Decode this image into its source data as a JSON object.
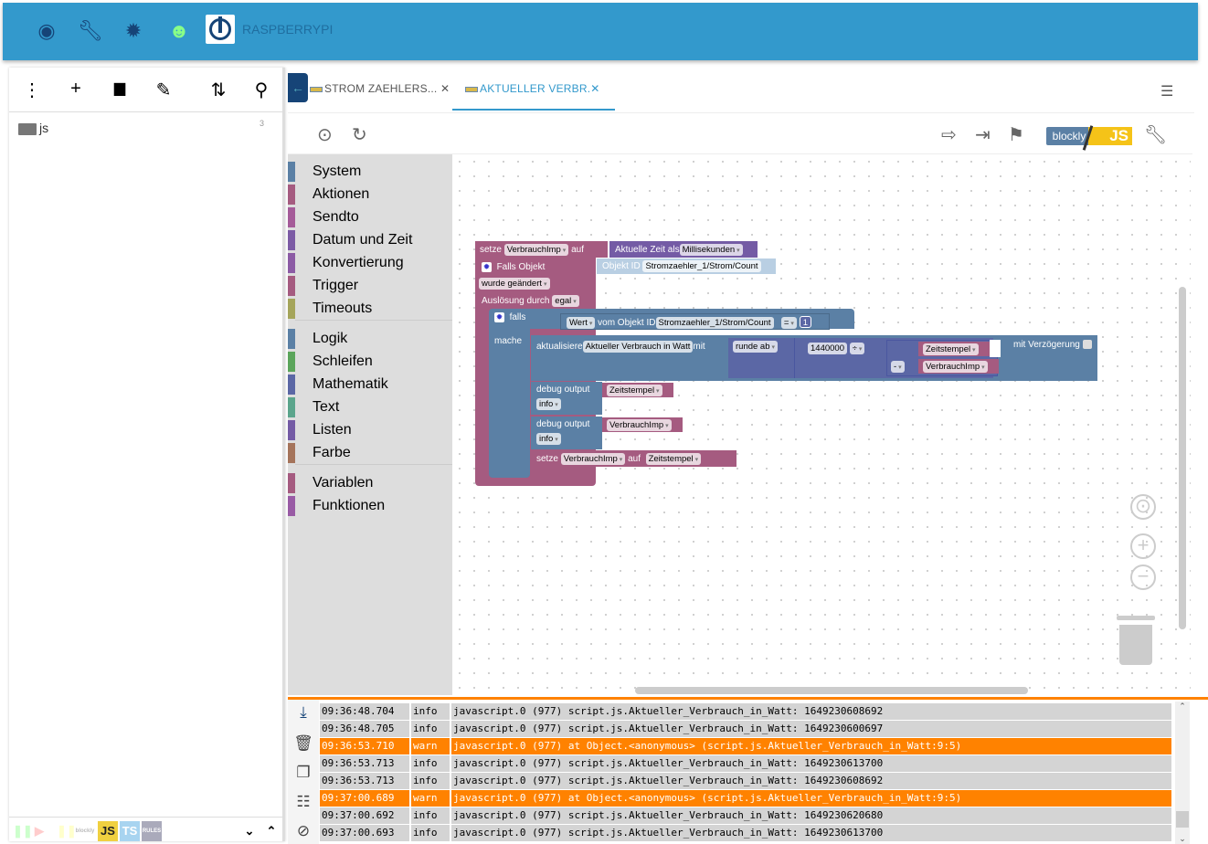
{
  "header": {
    "host": "RASPBERRYPI",
    "icons": [
      "eye-icon",
      "wrench-icon",
      "brightness-icon",
      "head-icon",
      "iobroker-logo"
    ]
  },
  "explorer": {
    "icons": [
      "more-icon",
      "add-icon",
      "add-folder-icon",
      "edit-icon",
      "sort-icon",
      "search-icon"
    ],
    "folder": {
      "name": "js",
      "count": "3"
    },
    "bottom": {
      "js": "JS",
      "ts": "TS",
      "rules": "RULES",
      "blockly": "blockly"
    }
  },
  "tabs": [
    {
      "label": "STROM ZAEHLERS...",
      "active": false
    },
    {
      "label": "AKTUELLER VERBR.",
      "active": true
    }
  ],
  "toolbar": {
    "blockly": "blockly",
    "js": "JS"
  },
  "categories": [
    {
      "label": "System",
      "color": "#5b80a5"
    },
    {
      "label": "Aktionen",
      "color": "#a55b80"
    },
    {
      "label": "Sendto",
      "color": "#a55b99"
    },
    {
      "label": "Datum und Zeit",
      "color": "#7c5ba5"
    },
    {
      "label": "Konvertierung",
      "color": "#8c5ba5"
    },
    {
      "label": "Trigger",
      "color": "#a55b80"
    },
    {
      "label": "Timeouts",
      "color": "#a5a55b"
    },
    {
      "label": "Logik",
      "color": "#5b80a5"
    },
    {
      "label": "Schleifen",
      "color": "#5ba55b"
    },
    {
      "label": "Mathematik",
      "color": "#5b67a5"
    },
    {
      "label": "Text",
      "color": "#5ba58c"
    },
    {
      "label": "Listen",
      "color": "#745ba5"
    },
    {
      "label": "Farbe",
      "color": "#a5745b"
    },
    {
      "label": "Variablen",
      "color": "#a55b80"
    },
    {
      "label": "Funktionen",
      "color": "#995ba5"
    }
  ],
  "blocks": {
    "setze": "setze",
    "auf": "auf",
    "var1": "VerbrauchImp",
    "aktzeit": "Aktuelle Zeit als",
    "ms": "Millisekunden",
    "falls_objekt": "Falls Objekt",
    "objekt_id": "Objekt ID",
    "oid": "Stromzaehler_1/Strom/Count",
    "geaendert": "wurde geändert",
    "ausloesung": "Auslösung durch",
    "egal": "egal",
    "falls": "falls",
    "mache": "mache",
    "wert": "Wert",
    "vom_objekt": "vom Objekt ID",
    "eq": "=",
    "one": "1",
    "aktualisiere": "aktualisiere",
    "target": "Aktueller Verbrauch in Watt",
    "mit": "mit",
    "runde": "runde ab",
    "num": "1440000",
    "div": "÷",
    "minus": "-",
    "zeit": "Zeitstempel",
    "verz": "mit Verzögerung",
    "debug": "debug output",
    "info": "info"
  },
  "log": [
    {
      "time": "09:36:48.704",
      "sev": "info",
      "msg": "javascript.0 (977) script.js.Aktueller_Verbrauch_in_Watt: 1649230608692"
    },
    {
      "time": "09:36:48.705",
      "sev": "info",
      "msg": "javascript.0 (977) script.js.Aktueller_Verbrauch_in_Watt: 1649230600697"
    },
    {
      "time": "09:36:53.710",
      "sev": "warn",
      "msg": "javascript.0 (977) at Object.<anonymous> (script.js.Aktueller_Verbrauch_in_Watt:9:5)"
    },
    {
      "time": "09:36:53.713",
      "sev": "info",
      "msg": "javascript.0 (977) script.js.Aktueller_Verbrauch_in_Watt: 1649230613700"
    },
    {
      "time": "09:36:53.713",
      "sev": "info",
      "msg": "javascript.0 (977) script.js.Aktueller_Verbrauch_in_Watt: 1649230608692"
    },
    {
      "time": "09:37:00.689",
      "sev": "warn",
      "msg": "javascript.0 (977) at Object.<anonymous> (script.js.Aktueller_Verbrauch_in_Watt:9:5)"
    },
    {
      "time": "09:37:00.692",
      "sev": "info",
      "msg": "javascript.0 (977) script.js.Aktueller_Verbrauch_in_Watt: 1649230620680"
    },
    {
      "time": "09:37:00.693",
      "sev": "info",
      "msg": "javascript.0 (977) script.js.Aktueller_Verbrauch_in_Watt: 1649230613700"
    }
  ],
  "colors": {
    "accent": "#3399cc",
    "warn": "#ff8200",
    "dark": "#164477"
  }
}
